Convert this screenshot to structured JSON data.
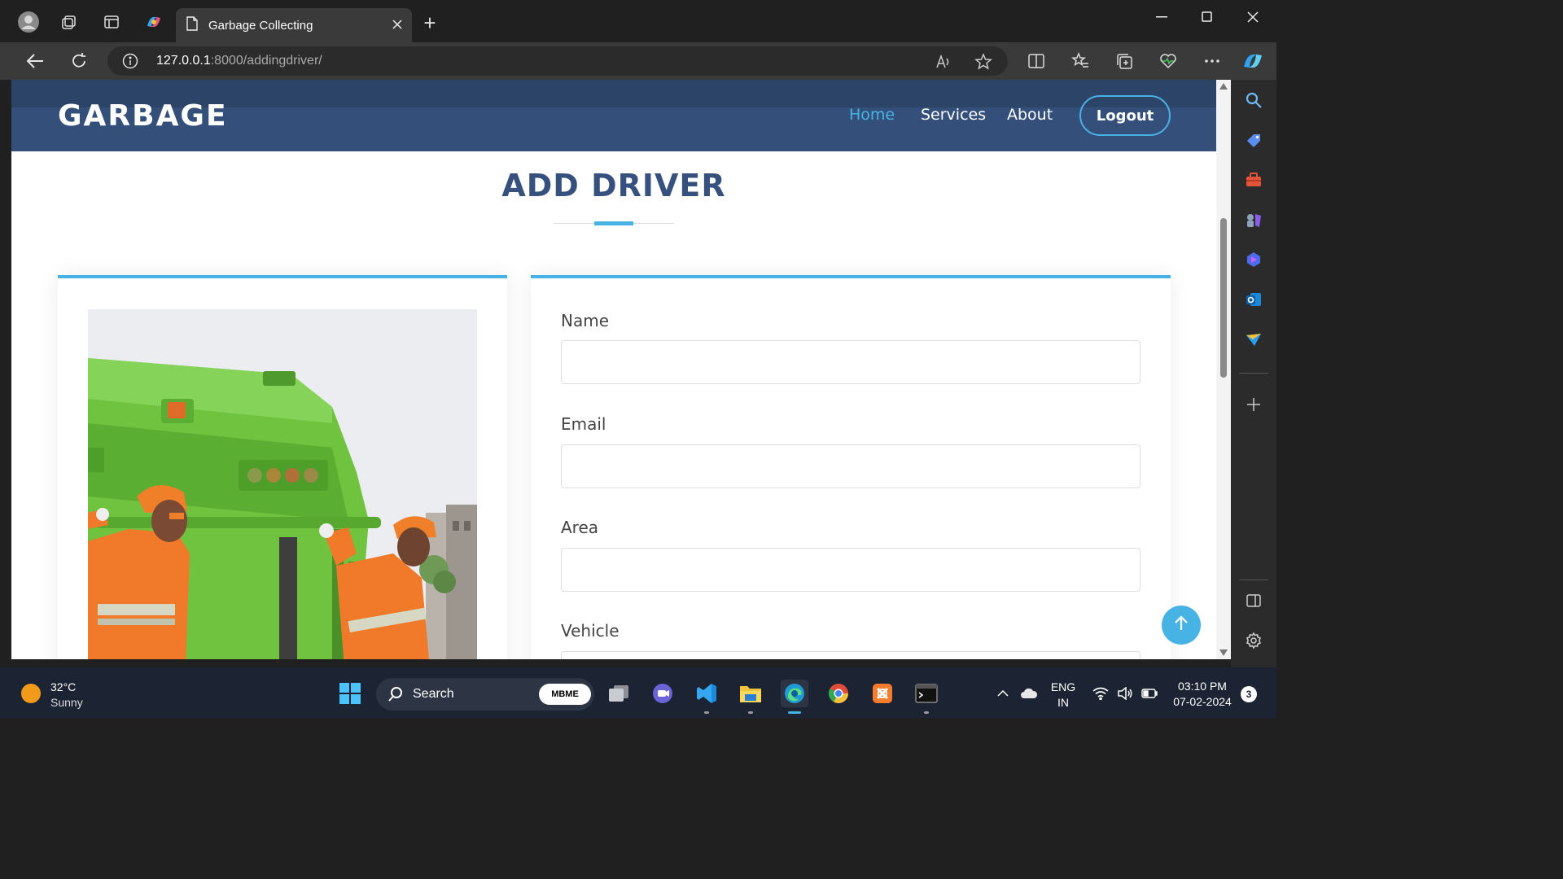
{
  "browser": {
    "tab_title": "Garbage Collecting",
    "url_host": "127.0.0.1",
    "url_rest": ":8000/addingdriver/"
  },
  "site": {
    "logo": "GARBAGE",
    "nav": {
      "home": "Home",
      "services": "Services",
      "about": "About",
      "logout": "Logout"
    },
    "section_title": "ADD DRIVER",
    "form": {
      "name_label": "Name",
      "email_label": "Email",
      "area_label": "Area",
      "vehicle_label": "Vehicle",
      "name_value": "",
      "email_value": "",
      "area_value": "",
      "vehicle_value": ""
    },
    "colors": {
      "header": "#34507a",
      "accent": "#47b2e4",
      "title": "#37517e"
    }
  },
  "taskbar": {
    "weather_temp": "32°C",
    "weather_desc": "Sunny",
    "search_label": "Search",
    "mbme_label": "MBME",
    "lang_top": "ENG",
    "lang_bottom": "IN",
    "time": "03:10 PM",
    "date": "07-02-2024",
    "notifications": "3"
  },
  "icons": [
    "profile-icon",
    "workspaces-icon",
    "tab-actions-icon",
    "copilot-icon",
    "page-icon",
    "close-icon",
    "new-tab-icon",
    "back-icon",
    "refresh-icon",
    "info-icon",
    "read-aloud-icon",
    "favorite-star-icon",
    "split-screen-icon",
    "favorites-icon",
    "collections-icon",
    "health-icon",
    "more-icon",
    "search-icon",
    "shopping-tag-icon",
    "tools-icon",
    "games-icon",
    "bing-icon",
    "outlook-icon",
    "send-icon",
    "add-icon",
    "sidebar-toggle-icon",
    "settings-icon",
    "arrow-up-icon",
    "windows-start-icon"
  ]
}
